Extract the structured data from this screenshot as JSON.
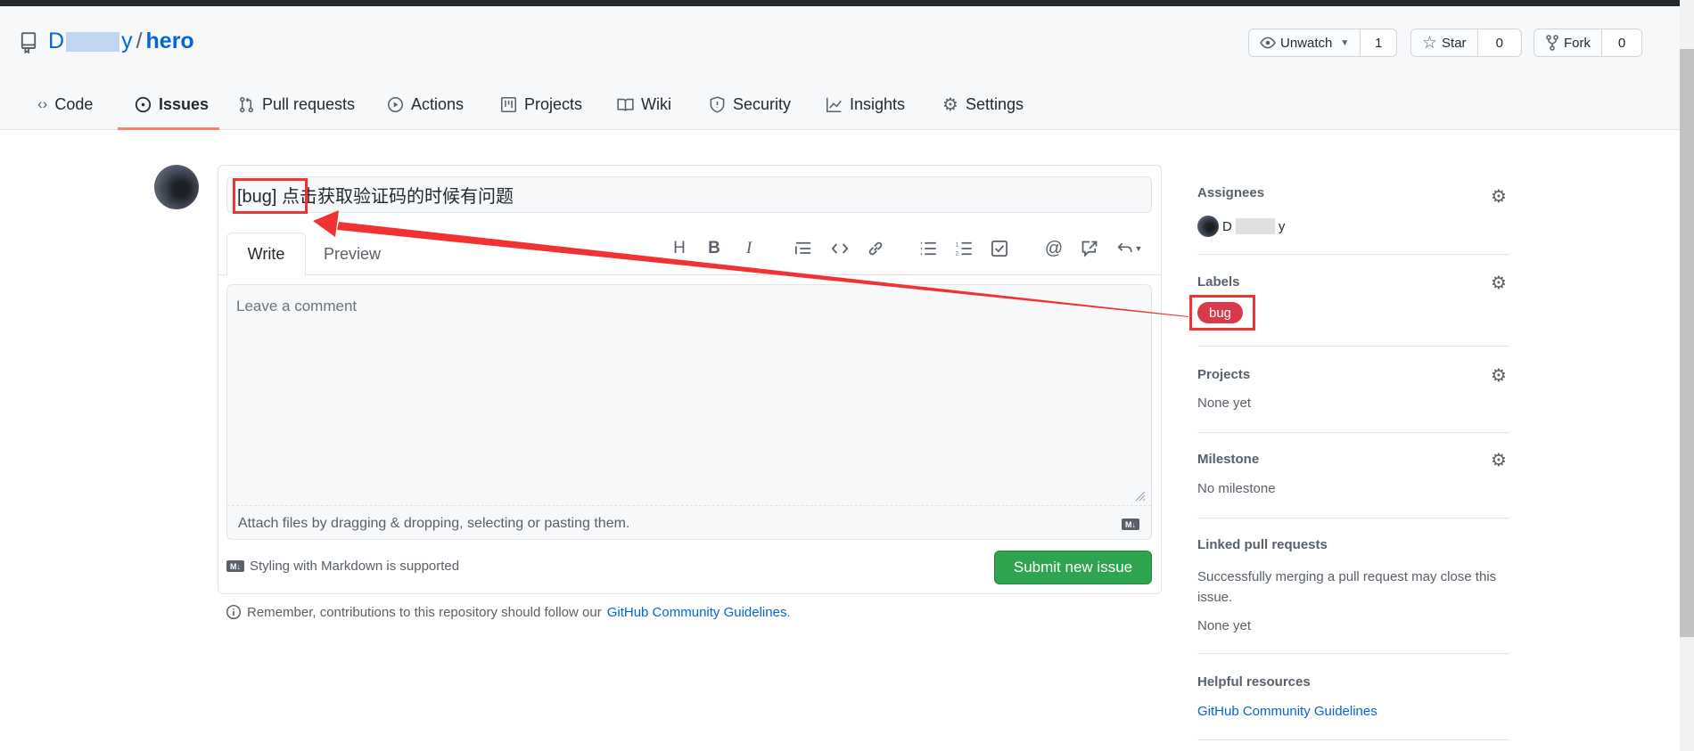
{
  "repo": {
    "owner_visible": "D",
    "owner_tail": "y",
    "separator": "/",
    "name": "hero"
  },
  "actions": {
    "watch": {
      "label": "Unwatch",
      "count": "1"
    },
    "star": {
      "label": "Star",
      "count": "0"
    },
    "fork": {
      "label": "Fork",
      "count": "0"
    }
  },
  "tabs": [
    {
      "label": "Code",
      "icon": "code-icon"
    },
    {
      "label": "Issues",
      "icon": "issue-opened-icon",
      "active": true
    },
    {
      "label": "Pull requests",
      "icon": "git-pull-request-icon"
    },
    {
      "label": "Actions",
      "icon": "play-icon"
    },
    {
      "label": "Projects",
      "icon": "project-icon"
    },
    {
      "label": "Wiki",
      "icon": "book-icon"
    },
    {
      "label": "Security",
      "icon": "shield-icon"
    },
    {
      "label": "Insights",
      "icon": "graph-icon"
    },
    {
      "label": "Settings",
      "icon": "gear-icon"
    }
  ],
  "issue": {
    "title_value": "[bug] 点击获取验证码的时候有问题",
    "write_tab": "Write",
    "preview_tab": "Preview",
    "comment_placeholder": "Leave a comment",
    "attach_hint": "Attach files by dragging & dropping, selecting or pasting them.",
    "markdown_note": "Styling with Markdown is supported",
    "submit_label": "Submit new issue",
    "guidelines_prefix": "Remember, contributions to this repository should follow our",
    "guidelines_link": "GitHub Community Guidelines",
    "guidelines_suffix": ".",
    "md_badge": "M↓"
  },
  "toolbar": [
    "heading",
    "bold",
    "italic",
    "quote",
    "code",
    "link",
    "unordered-list",
    "ordered-list",
    "task-list",
    "mention",
    "reference",
    "reply"
  ],
  "sidebar": {
    "assignees": {
      "title": "Assignees",
      "user_visible": "D",
      "user_tail": "y"
    },
    "labels": {
      "title": "Labels",
      "items": [
        {
          "name": "bug",
          "color": "#d73a4a"
        }
      ]
    },
    "projects": {
      "title": "Projects",
      "value": "None yet"
    },
    "milestone": {
      "title": "Milestone",
      "value": "No milestone"
    },
    "linked_prs": {
      "title": "Linked pull requests",
      "desc": "Successfully merging a pull request may close this issue.",
      "value": "None yet"
    },
    "helpful": {
      "title": "Helpful resources",
      "link": "GitHub Community Guidelines"
    }
  },
  "colors": {
    "accent": "#0366d6",
    "submit": "#2ea44f",
    "tab_underline": "#f9826c",
    "annotation": "#f03232"
  }
}
